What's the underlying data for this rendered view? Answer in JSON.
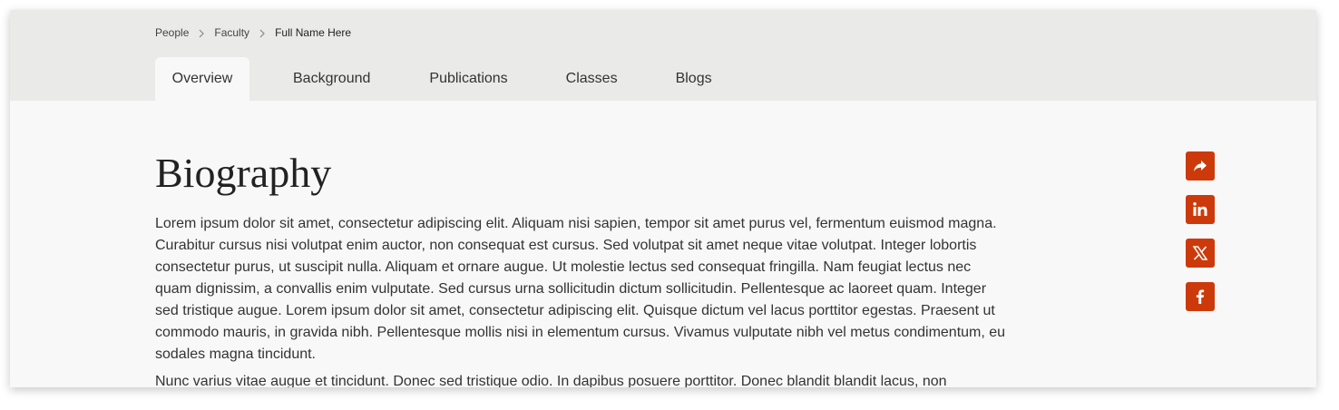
{
  "breadcrumb": {
    "items": [
      "People",
      "Faculty"
    ],
    "current": "Full Name Here"
  },
  "tabs": [
    {
      "label": "Overview",
      "active": true
    },
    {
      "label": "Background",
      "active": false
    },
    {
      "label": "Publications",
      "active": false
    },
    {
      "label": "Classes",
      "active": false
    },
    {
      "label": "Blogs",
      "active": false
    }
  ],
  "main": {
    "title": "Biography",
    "paragraphs": [
      "Lorem ipsum dolor sit amet, consectetur adipiscing elit. Aliquam nisi sapien, tempor sit amet purus vel, fermentum euismod magna. Curabitur cursus nisi volutpat enim auctor, non consequat est cursus. Sed volutpat sit amet neque vitae volutpat. Integer lobortis consectetur purus, ut suscipit nulla. Aliquam et ornare augue. Ut molestie lectus sed consequat fringilla. Nam feugiat lectus nec quam dignissim, a convallis enim vulputate. Sed cursus urna sollicitudin dictum sollicitudin. Pellentesque ac laoreet quam. Integer sed tristique augue. Lorem ipsum dolor sit amet, consectetur adipiscing elit. Quisque dictum vel lacus porttitor egestas. Praesent ut commodo mauris, in gravida nibh. Pellentesque mollis nisi in elementum cursus. Vivamus vulputate nibh vel metus condimentum, eu sodales magna tincidunt.",
      "Nunc varius vitae augue et tincidunt. Donec sed tristique odio. In dapibus posuere porttitor. Donec blandit blandit lacus, non"
    ]
  },
  "share": {
    "icons": [
      "share-icon",
      "linkedin-icon",
      "x-icon",
      "facebook-icon"
    ],
    "color": "#cc3a0b"
  },
  "colors": {
    "header_bg": "#eaeae8",
    "content_bg": "#f8f8f8",
    "accent": "#cc3a0b"
  }
}
